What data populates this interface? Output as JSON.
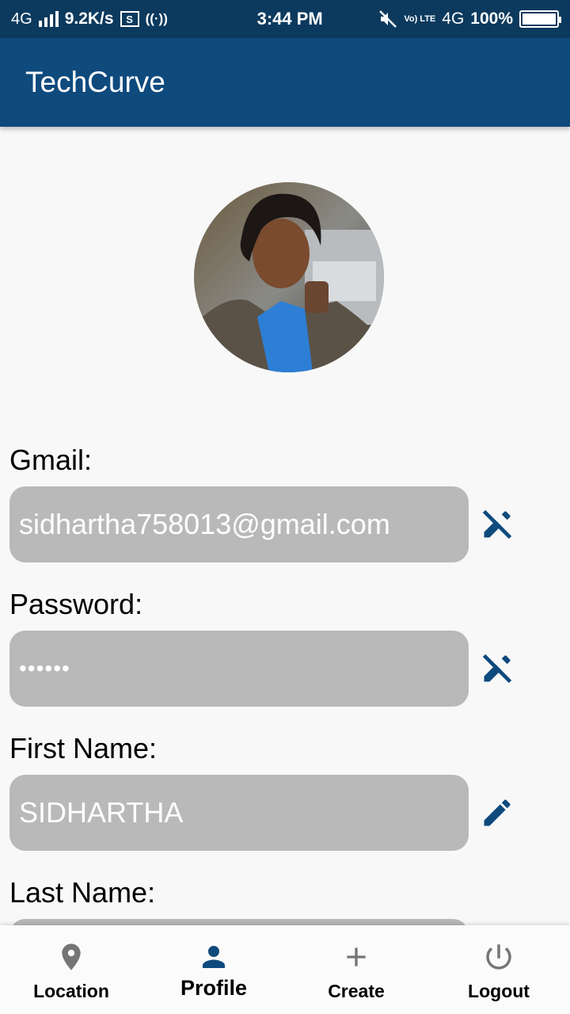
{
  "status_bar": {
    "network": "4G",
    "speed": "9.2K/s",
    "time": "3:44 PM",
    "volte": "Vo) LTE",
    "network_right": "4G",
    "battery": "100%"
  },
  "app": {
    "title": "TechCurve"
  },
  "profile": {
    "fields": [
      {
        "label": "Gmail:",
        "value": "sidhartha758013@gmail.com",
        "edit_icon": "edit-off-icon"
      },
      {
        "label": "Password:",
        "value": "••••••",
        "edit_icon": "edit-off-icon"
      },
      {
        "label": "First Name:",
        "value": "SIDHARTHA",
        "edit_icon": "pencil-icon"
      },
      {
        "label": "Last Name:",
        "value": "",
        "edit_icon": "pencil-icon"
      }
    ]
  },
  "bottom_nav": {
    "items": [
      {
        "label": "Location",
        "icon": "location-pin-icon"
      },
      {
        "label": "Profile",
        "icon": "person-icon",
        "active": true
      },
      {
        "label": "Create",
        "icon": "plus-icon"
      },
      {
        "label": "Logout",
        "icon": "power-icon"
      }
    ]
  },
  "colors": {
    "primary": "#0f4a7d",
    "status_bar": "#0c3a5e",
    "field_bg": "#b9b9b9",
    "icon_inactive": "#757575"
  }
}
